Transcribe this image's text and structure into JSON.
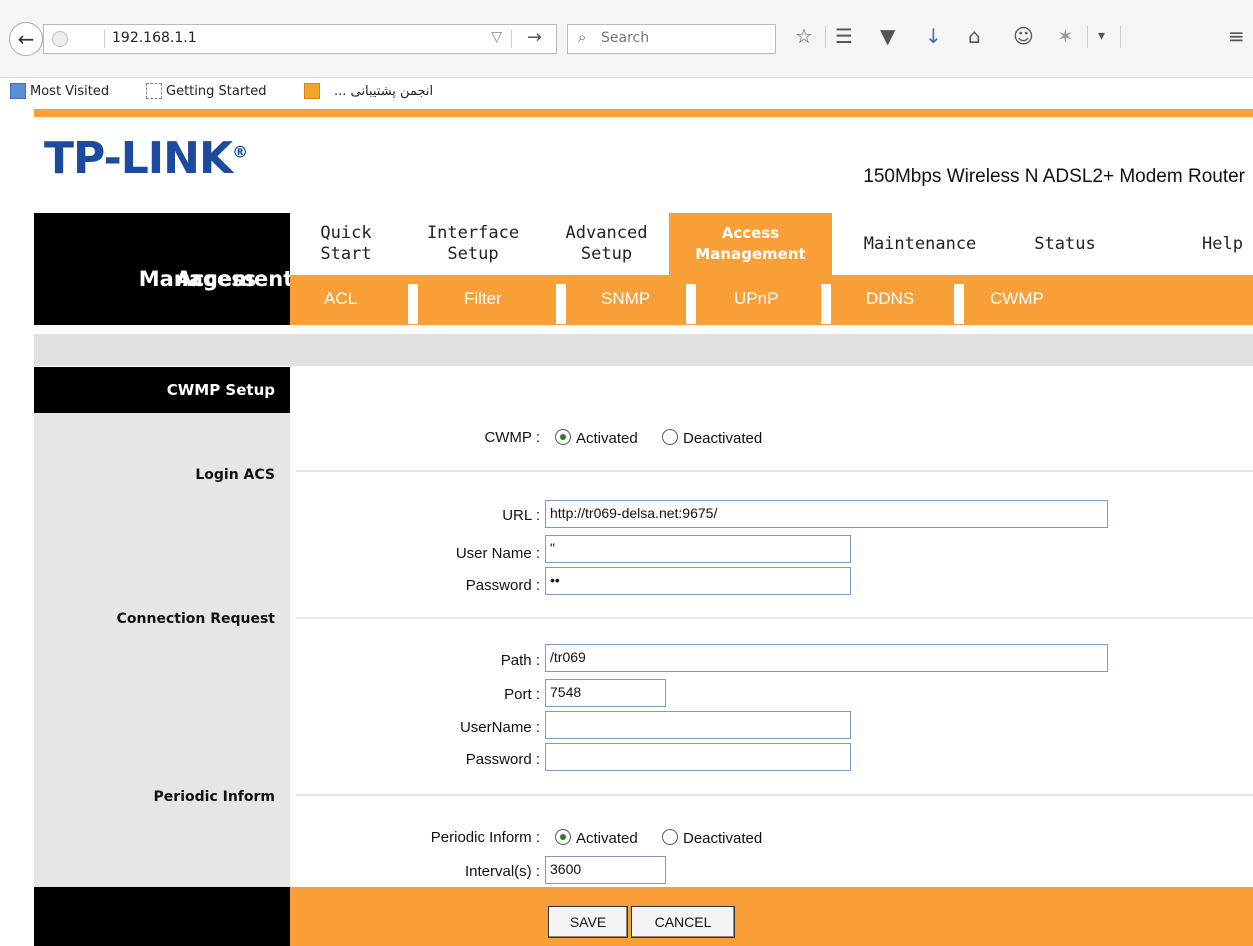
{
  "browser": {
    "url": "192.168.1.1",
    "search_placeholder": "Search",
    "bookmarks": [
      "Most Visited",
      "Getting Started",
      "... انجمن پشتیبانی"
    ]
  },
  "header": {
    "brand": "TP-LINK",
    "brand_mark": "®",
    "model": "150Mbps Wireless N ADSL2+ Modem Router"
  },
  "nav": {
    "section_line1": "Access",
    "section_line2": "Management",
    "tabs": [
      {
        "line1": "Quick",
        "line2": "Start"
      },
      {
        "line1": "Interface",
        "line2": "Setup"
      },
      {
        "line1": "Advanced",
        "line2": "Setup"
      },
      {
        "line1": "Access",
        "line2": "Management"
      },
      {
        "line1": "Maintenance",
        "line2": ""
      },
      {
        "line1": "Status",
        "line2": ""
      },
      {
        "line1": "Help",
        "line2": ""
      }
    ],
    "subtabs": [
      "ACL",
      "Filter",
      "SNMP",
      "UPnP",
      "DDNS",
      "CWMP"
    ]
  },
  "sidebar": {
    "title": "CWMP Setup",
    "login_acs": "Login ACS",
    "connection_request": "Connection Request",
    "periodic_inform": "Periodic Inform"
  },
  "form": {
    "cwmp_label": "CWMP :",
    "activated": "Activated",
    "deactivated": "Deactivated",
    "url_label": "URL :",
    "url_value": "http://tr069-delsa.net:9675/",
    "acs_username_label": "User Name :",
    "acs_username_value": "\"",
    "acs_password_label": "Password :",
    "acs_password_value": "••",
    "path_label": "Path :",
    "path_value": "/tr069",
    "port_label": "Port :",
    "port_value": "7548",
    "cr_username_label": "UserName :",
    "cr_username_value": "",
    "cr_password_label": "Password :",
    "cr_password_value": "",
    "periodic_label": "Periodic Inform :",
    "interval_label": "Interval(s) :",
    "interval_value": "3600"
  },
  "buttons": {
    "save": "SAVE",
    "cancel": "CANCEL"
  },
  "colors": {
    "accent": "#f99f38",
    "brand": "#1b4a9e"
  }
}
